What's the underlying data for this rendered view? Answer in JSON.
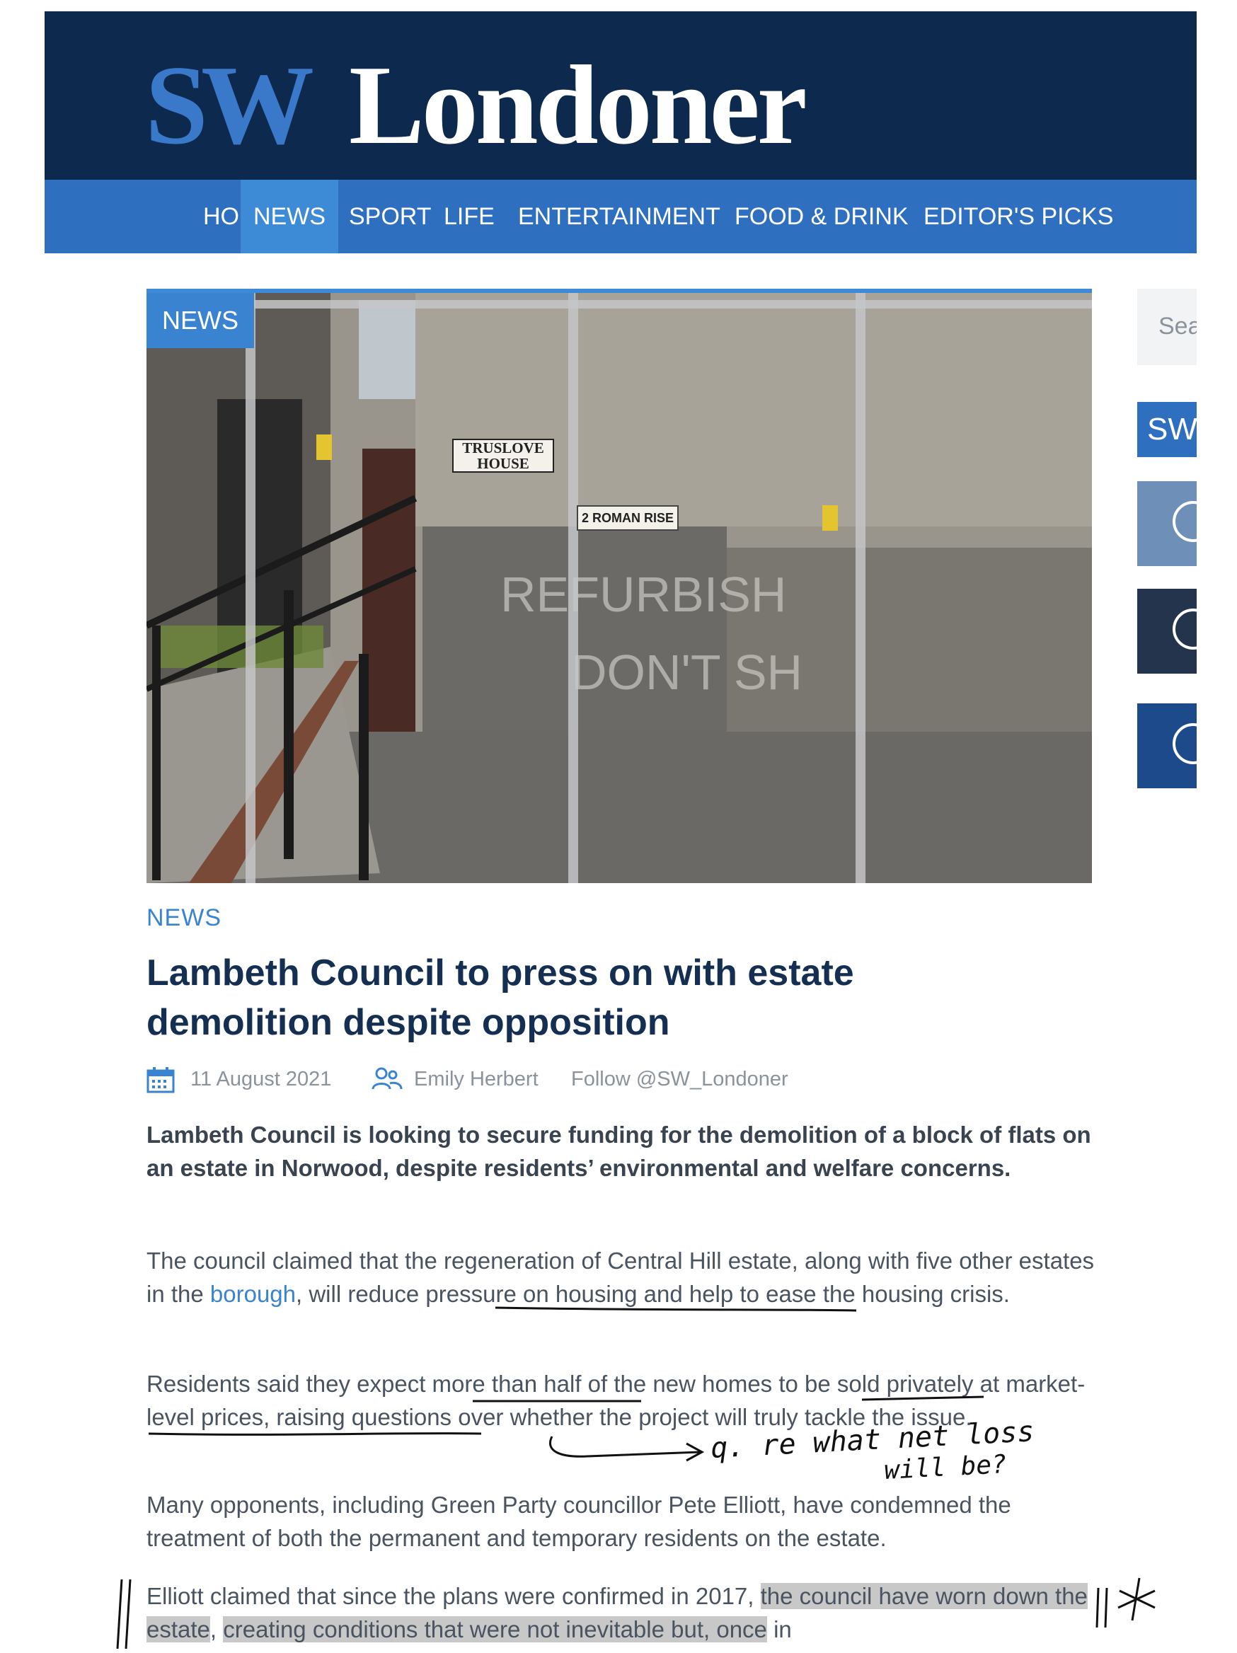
{
  "header": {
    "logo_sw": "SW",
    "logo_name": "Londoner"
  },
  "nav": {
    "items": [
      "HOME",
      "NEWS",
      "SPORT",
      "LIFE",
      "ENTERTAINMENT",
      "FOOD & DRINK",
      "EDITOR'S PICKS"
    ],
    "active": "NEWS"
  },
  "hero": {
    "tag": "NEWS",
    "sign_truslove": "TRUSLOVE\nHOUSE",
    "sign_roman": "2 ROMAN RISE"
  },
  "sidebar": {
    "search_placeholder": "Sea",
    "sw_label": "SW"
  },
  "article": {
    "category": "NEWS",
    "title": "Lambeth Council to press on with estate demolition despite opposition",
    "date": "11 August 2021",
    "author": "Emily Herbert",
    "follow": "Follow @SW_Londoner",
    "lede": "Lambeth Council is looking to secure funding for the demolition of a block of flats on an estate in Norwood, despite residents’ environmental and welfare concerns.",
    "p1_a": "The council claimed that the regeneration of Central Hill estate, along with five other estates in the ",
    "p1_link": "borough",
    "p1_b": ", will reduce pressure on housing and help to ease the housing crisis.",
    "p2": "Residents said they expect more than half of the new homes to be sold privately at market-level prices, raising questions over whether the project will truly tackle the issue.",
    "p3": "Many opponents, including Green Party councillor Pete Elliott, have condemned the treatment of both the permanent and temporary residents on the estate.",
    "p4_a": "Elliott claimed that since the plans were confirmed in 2017, ",
    "p4_hl1": "the council have worn down the estate",
    "p4_b": ", ",
    "p4_hl2": "creating conditions that were not inevitable but, once",
    "p4_c": " in"
  },
  "annotations": {
    "note_line1": "q. re what net loss",
    "note_line2": "will be?"
  },
  "colors": {
    "masthead": "#0d2a4e",
    "nav": "#2f6fc0",
    "accent": "#3a83d0",
    "headline": "#142f52"
  }
}
